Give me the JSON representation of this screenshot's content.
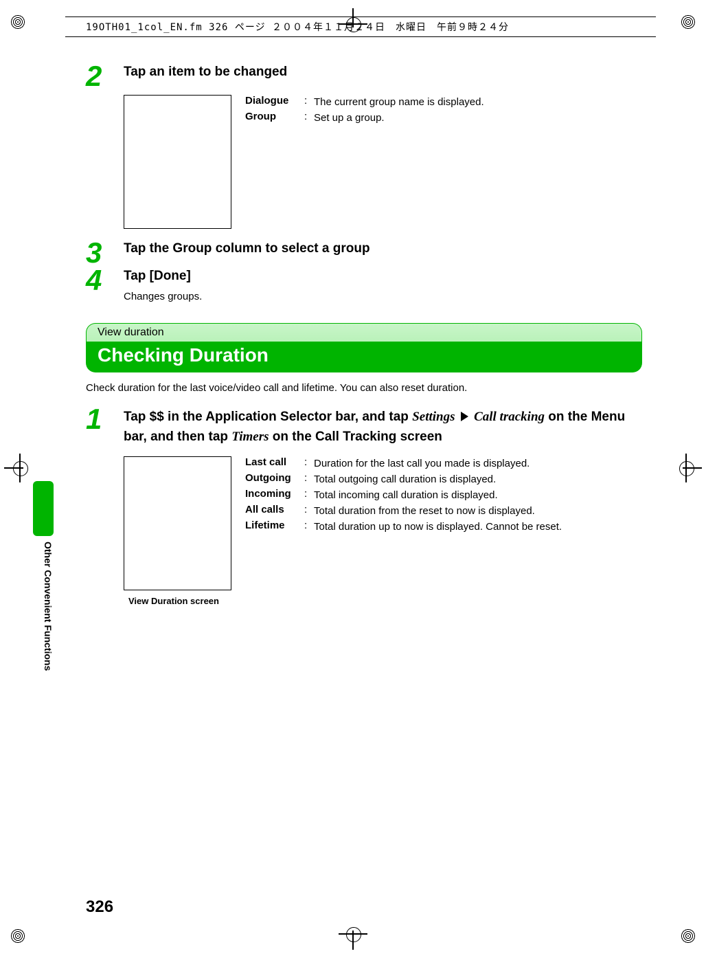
{
  "print_header": "19OTH01_1col_EN.fm  326 ページ  ２００４年１１月２４日　水曜日　午前９時２４分",
  "steps_a": [
    {
      "num": "2",
      "title": "Tap an item to be changed",
      "defs": [
        {
          "term": "Dialogue",
          "desc": "The current group name is displayed."
        },
        {
          "term": "Group",
          "desc": "Set up a group."
        }
      ]
    },
    {
      "num": "3",
      "title": "Tap the Group column to select a group"
    },
    {
      "num": "4",
      "title": "Tap [Done]",
      "subtext": "Changes groups."
    }
  ],
  "section": {
    "eyebrow": "View duration",
    "title": "Checking Duration",
    "desc": "Check duration for the last voice/video call and lifetime. You can also reset duration."
  },
  "step_b": {
    "num": "1",
    "title_parts": {
      "t1": "Tap $$ in the Application Selector bar, and tap ",
      "i1": "Settings",
      "i2": "Call tracking",
      "t2": " on the Menu bar, and then tap ",
      "i3": "Timers",
      "t3": " on the Call Tracking screen"
    },
    "defs": [
      {
        "term": "Last call",
        "desc": "Duration for the last call you made is displayed."
      },
      {
        "term": "Outgoing",
        "desc": "Total outgoing call duration is displayed."
      },
      {
        "term": "Incoming",
        "desc": "Total incoming call duration is displayed."
      },
      {
        "term": "All calls",
        "desc": "Total duration from the reset to now is displayed."
      },
      {
        "term": "Lifetime",
        "desc": "Total duration up to now is displayed. Cannot be reset."
      }
    ],
    "caption": "View Duration screen"
  },
  "side_label": "Other Convenient Functions",
  "page_number": "326"
}
